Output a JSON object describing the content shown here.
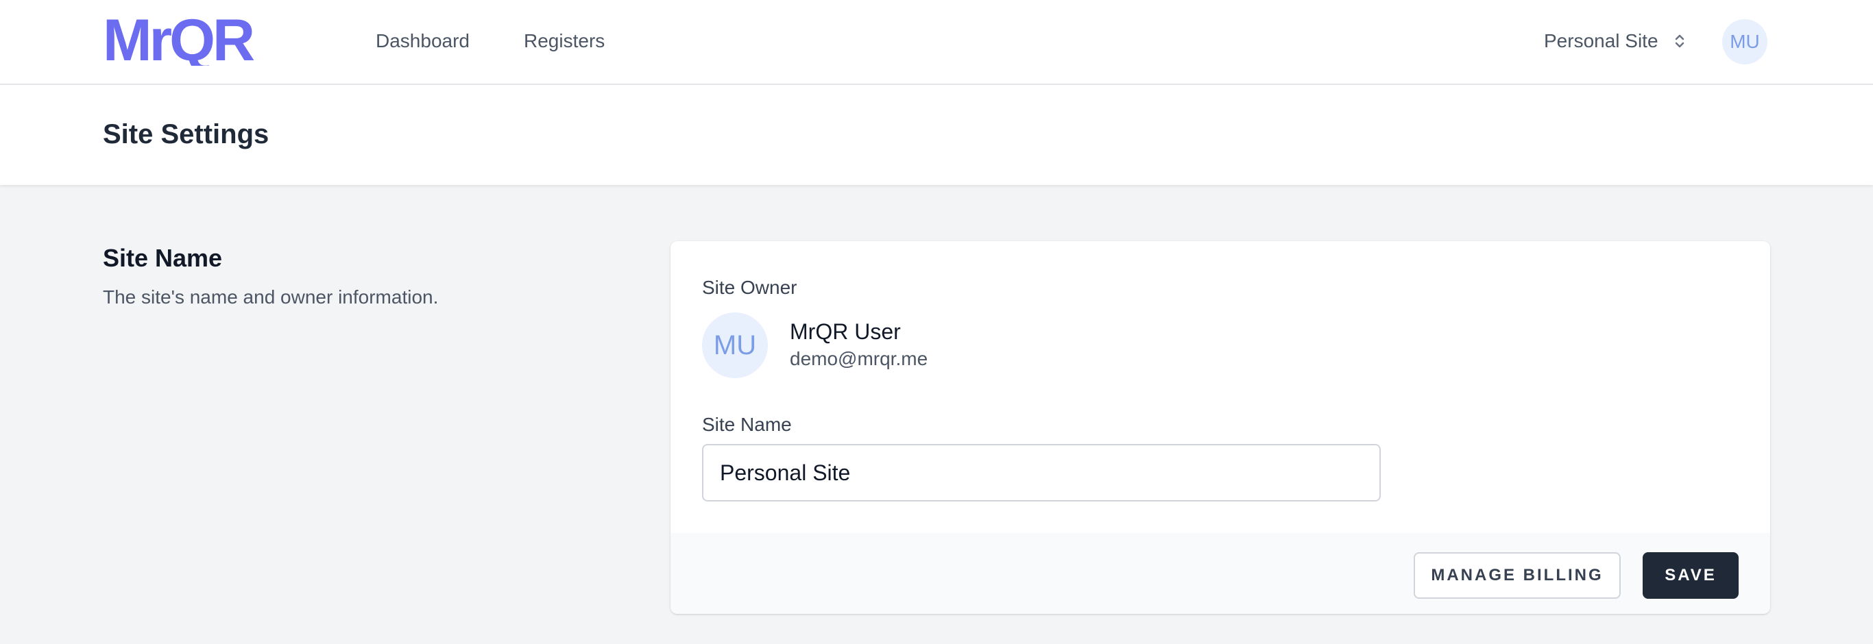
{
  "brand": {
    "logo_text": "MrQR",
    "accent_color": "#6b6cf0"
  },
  "nav": {
    "links": [
      {
        "label": "Dashboard"
      },
      {
        "label": "Registers"
      }
    ],
    "site_switcher": {
      "label": "Personal Site",
      "icon": "chevron-up-down-icon"
    },
    "user_avatar": "MU"
  },
  "header": {
    "title": "Site Settings"
  },
  "section": {
    "title": "Site Name",
    "description": "The site's name and owner information."
  },
  "card": {
    "owner_label": "Site Owner",
    "owner": {
      "initials": "MU",
      "name": "MrQR User",
      "email": "demo@mrqr.me"
    },
    "site_name_label": "Site Name",
    "site_name_value": "Personal Site"
  },
  "footer": {
    "manage_billing_label": "MANAGE BILLING",
    "save_label": "SAVE"
  }
}
